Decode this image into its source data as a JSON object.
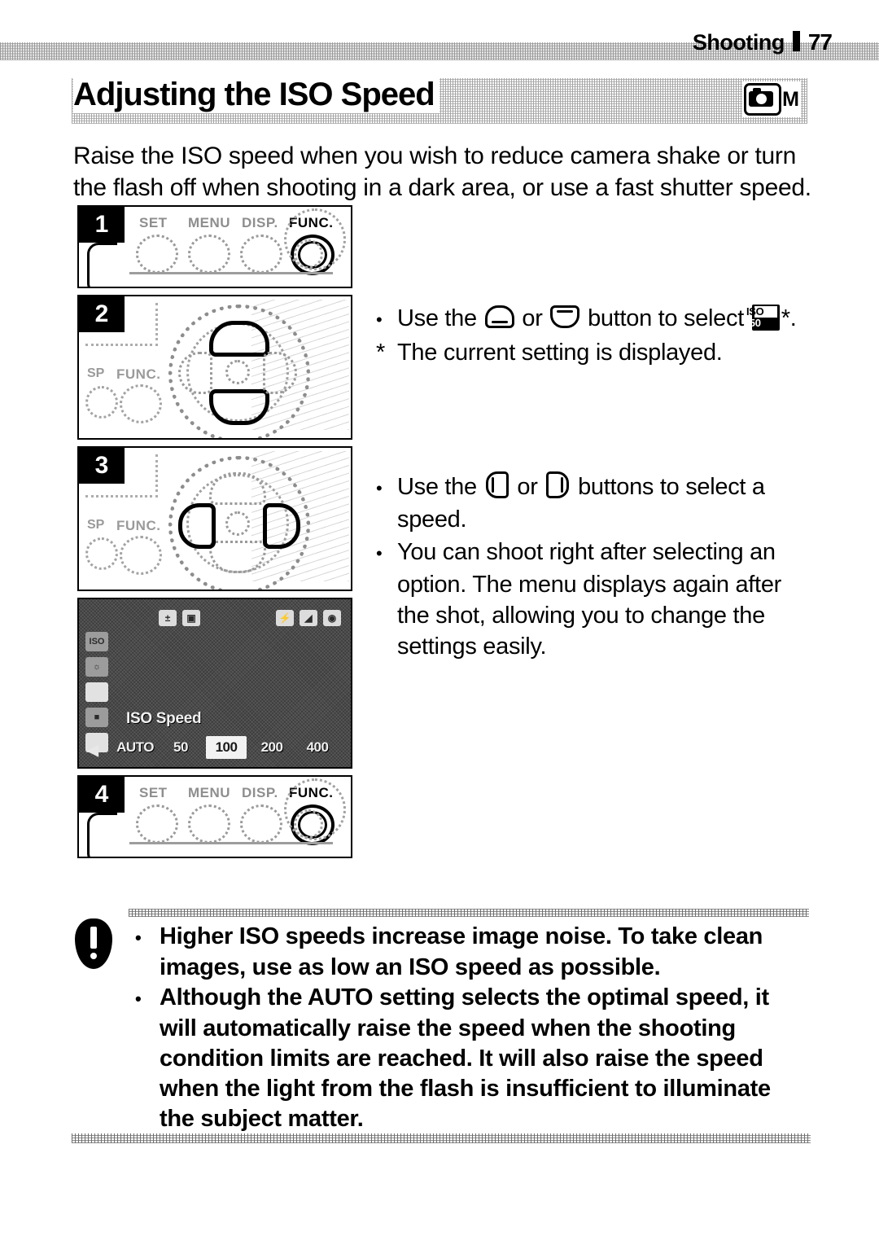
{
  "header": {
    "section": "Shooting",
    "page_number": "77"
  },
  "title": {
    "text": "Adjusting the ISO Speed",
    "mode_badge": {
      "camera_icon": "camera-icon",
      "mode_letter": "M"
    }
  },
  "intro": "Raise the ISO speed when you wish to reduce camera shake or turn the flash off when shooting in a dark area, or use a fast shutter speed.",
  "figures": [
    {
      "step": "1",
      "type": "button-row",
      "labels": [
        "SET",
        "MENU",
        "DISP.",
        "FUNC."
      ],
      "highlighted": "FUNC."
    },
    {
      "step": "2",
      "type": "dial",
      "highlighted_buttons": [
        "up",
        "down"
      ],
      "side_labels": [
        "SP",
        "FUNC."
      ]
    },
    {
      "step": "3",
      "type": "dial",
      "highlighted_buttons": [
        "left",
        "right"
      ],
      "side_labels": [
        "SP",
        "FUNC."
      ]
    },
    {
      "step": "4",
      "type": "button-row",
      "labels": [
        "SET",
        "MENU",
        "DISP.",
        "FUNC."
      ],
      "highlighted": "FUNC."
    }
  ],
  "lcd": {
    "menu_label": "ISO Speed",
    "options": [
      "AUTO",
      "50",
      "100",
      "200",
      "400"
    ],
    "selected_option": "100",
    "top_icons": [
      "exposure-icon",
      "white-balance-icon",
      "flash-icon",
      "macro-icon",
      "drive-mode-icon"
    ],
    "left_icons": [
      "iso-icon",
      "effect-icon",
      "size-icon",
      "quality-icon",
      "compression-icon"
    ],
    "left_arrow": "◀"
  },
  "steps": {
    "step2": {
      "bullet_pre": "Use the ",
      "bullet_mid": " or ",
      "bullet_post": " button to select ",
      "bullet_end": "*.",
      "iso_icon_top": "ISO",
      "iso_icon_bottom": "50",
      "footnote": "The current setting is displayed."
    },
    "step3": {
      "bullet1_pre": "Use the ",
      "bullet1_mid": " or ",
      "bullet1_post": " buttons to select a speed.",
      "bullet2": "You can shoot right after selecting an option. The menu displays again after the shot, allowing you to change the settings easily."
    }
  },
  "note": {
    "icon": "warning-icon",
    "bullets": [
      "Higher ISO speeds increase image noise. To take clean images, use as low an ISO speed as possible.",
      "Although the AUTO setting selects the optimal speed, it will automatically raise the speed when the shooting condition limits are reached. It will also raise the speed when the light from the flash is insufficient to illuminate the subject matter."
    ]
  }
}
